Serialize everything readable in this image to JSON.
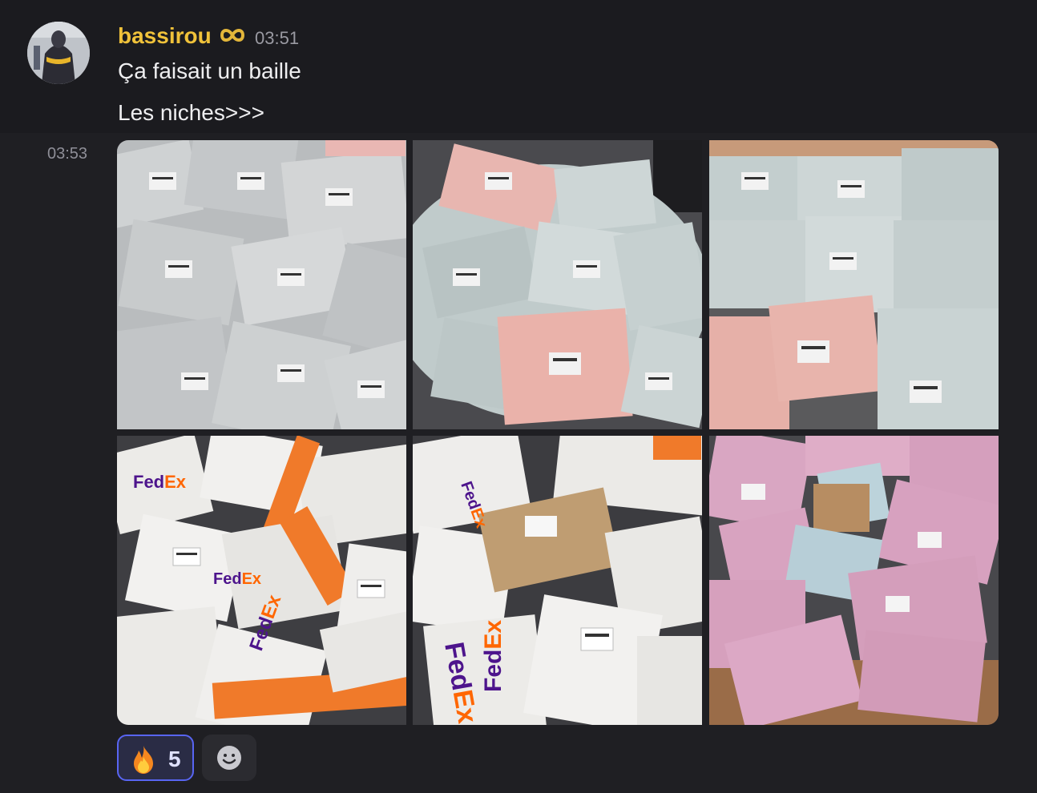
{
  "message": {
    "username": "bassirou",
    "badge_icon": "infinity-icon",
    "username_color": "#f0c23a",
    "timestamp": "03:51",
    "lines": [
      "Ça faisait un baille",
      "Les niches>>>"
    ]
  },
  "attachment_group": {
    "timestamp": "03:53",
    "image_count": 6,
    "images": [
      {
        "description": "pile of grey parcels with labels"
      },
      {
        "description": "grey and pink parcels on carpet"
      },
      {
        "description": "grey and pink parcels on floor"
      },
      {
        "description": "FedEx white and orange parcels"
      },
      {
        "description": "FedEx parcels with cardboard box"
      },
      {
        "description": "pink and light blue parcels with box"
      }
    ]
  },
  "reactions": [
    {
      "emoji": "fire-icon",
      "count": "5",
      "selected": true
    }
  ],
  "add_reaction_icon": "smiley-add-icon",
  "colors": {
    "accent": "#5865f2",
    "background": "#1f1f23"
  }
}
